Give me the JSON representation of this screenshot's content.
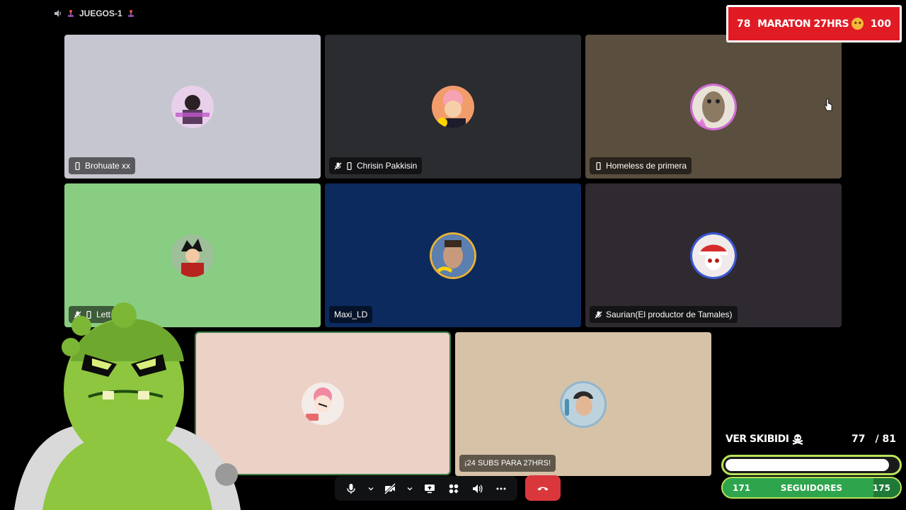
{
  "channel": {
    "name": "JUEGOS-1"
  },
  "participants": [
    {
      "name": "Brohuate xx",
      "mobile": true,
      "muted": false,
      "bg": "#c6c6d0"
    },
    {
      "name": "Chrisin Pakkisin",
      "mobile": true,
      "muted": true,
      "bg": "#2b2c30"
    },
    {
      "name": "Homeless de primera",
      "mobile": true,
      "muted": false,
      "bg": "#5a4e3e"
    },
    {
      "name": "Lett",
      "mobile": true,
      "muted": true,
      "bg": "#89cd82"
    },
    {
      "name": "Maxi_LD",
      "mobile": false,
      "muted": false,
      "bg": "#0c2a5e"
    },
    {
      "name": "Saurian(El productor de Tamales)",
      "mobile": false,
      "muted": true,
      "bg": "#2e2a30"
    },
    {
      "name": "",
      "mobile": false,
      "muted": false,
      "bg": "#ebd1c6"
    },
    {
      "name": "¡24 SUBS PARA 27HRS!",
      "mobile": false,
      "muted": false,
      "bg": "#d6c2a7"
    }
  ],
  "controls": {
    "icons": [
      "microphone-icon",
      "chevron-down-icon",
      "camera-off-icon",
      "chevron-down-icon",
      "screen-share-icon",
      "activities-icon",
      "soundboard-icon",
      "more-icon"
    ],
    "end_call_icon": "phone-hangup-icon"
  },
  "overlay": {
    "marathon": {
      "left": "78",
      "title": "MARATON 27HRS",
      "right": "100"
    },
    "skibidi": {
      "label": "VER SKIBIDI",
      "current": "77",
      "total": "/ 81",
      "progress": 0.95
    },
    "followers": {
      "label": "SEGUIDORES",
      "start": "171",
      "end": "175",
      "progress": 0.85
    }
  },
  "colors": {
    "end_call": "#da373c",
    "banner_red": "#e01b24",
    "progress_green": "#b9e25b"
  }
}
